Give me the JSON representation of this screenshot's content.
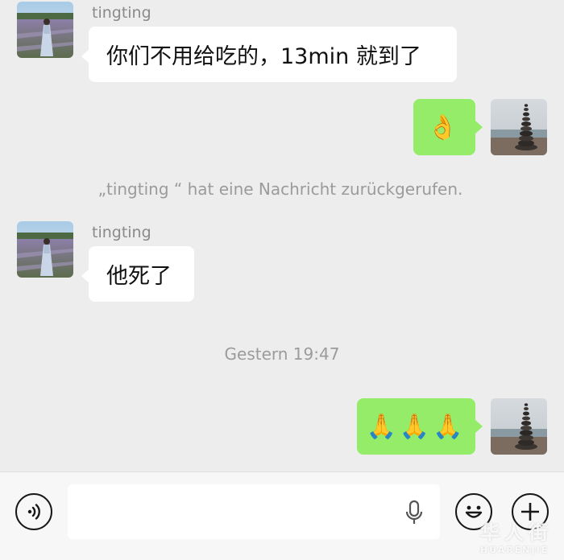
{
  "messages": [
    {
      "sender": "tingting",
      "text": "你们不用给吃的，13min 就到了"
    },
    {
      "emoji": "👌"
    },
    {
      "system": "„tingting “ hat eine Nachricht zurückgerufen."
    },
    {
      "sender": "tingting",
      "text": "他死了"
    },
    {
      "timestamp": "Gestern 19:47"
    },
    {
      "emoji": "🙏🙏🙏"
    }
  ],
  "icons": {
    "voice": "voice-toggle-icon",
    "mic": "microphone-icon",
    "emoji": "emoji-face-icon",
    "plus": "plus-icon"
  },
  "watermark": {
    "big": "华人街",
    "small": "HUARENJIE"
  },
  "colors": {
    "background": "#ededed",
    "bubble_in": "#ffffff",
    "bubble_out": "#95ec69"
  }
}
